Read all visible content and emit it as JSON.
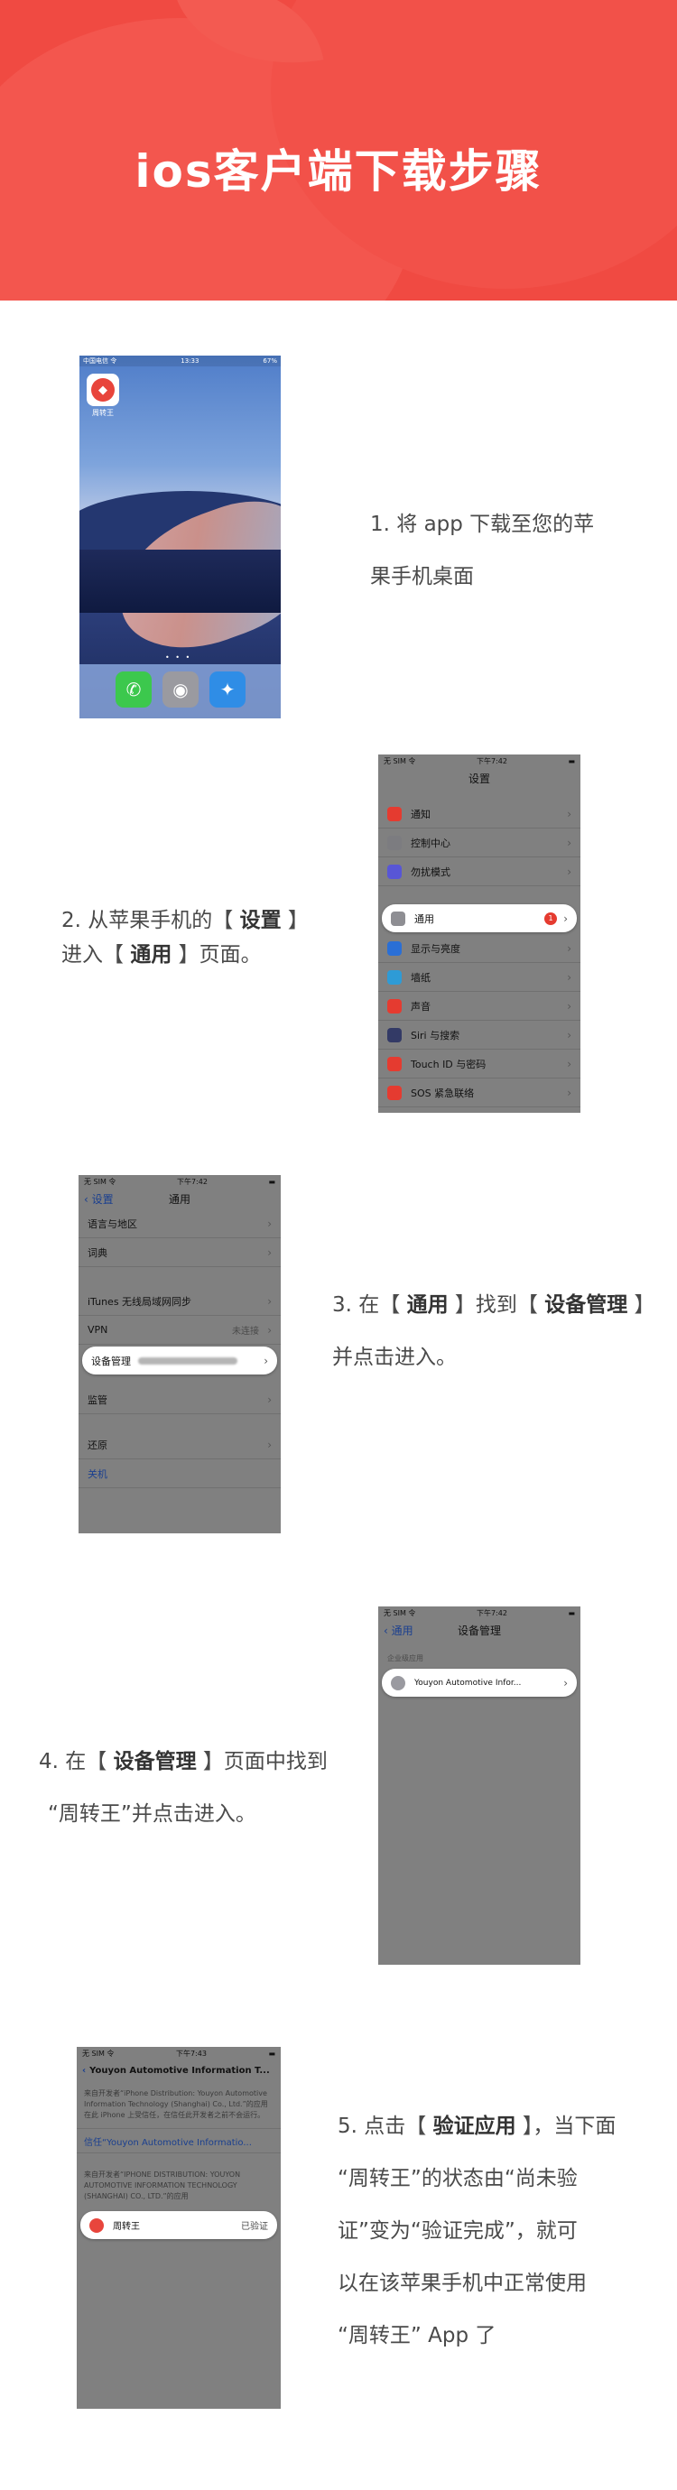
{
  "header": {
    "title": "ios客户端下载步骤"
  },
  "steps": {
    "step1": {
      "line1": "1. 将 app 下载至您的苹",
      "line2": "果手机桌面"
    },
    "step2": {
      "line1_prefix": "2. 从苹果手机的【 ",
      "line1_bold": "设置",
      "line1_suffix": " 】",
      "line2_prefix": "进入【 ",
      "line2_bold": "通用",
      "line2_suffix": " 】页面。"
    },
    "step3": {
      "line1_prefix": "3. 在【 ",
      "line1_bold1": "通用",
      "line1_mid": " 】找到【 ",
      "line1_bold2": "设备管理",
      "line1_suffix": " 】",
      "line2": "并点击进入。"
    },
    "step4": {
      "line1_prefix": "4. 在【 ",
      "line1_bold": "设备管理",
      "line1_suffix": " 】页面中找到",
      "line2": "“周转王”并点击进入。"
    },
    "step5": {
      "line1_prefix": "5. 点击【 ",
      "line1_bold": "验证应用",
      "line1_suffix": " 】，当下面",
      "line2": "“周转王”的状态由“尚未验",
      "line3": "证”变为“验证完成”，就可",
      "line4": "以在该苹果手机中正常使用",
      "line5": "“周转王” App 了"
    }
  },
  "screen1": {
    "status_left": "中国电信 令",
    "status_time": "13:33",
    "status_right": "67%",
    "app_name": "周转王",
    "dock_icons": [
      "phone-icon",
      "camera-icon",
      "safari-icon"
    ]
  },
  "screen2": {
    "status_left": "无 SIM 令",
    "status_time": "下午7:42",
    "title": "设置",
    "group1": [
      "通知",
      "控制中心",
      "勿扰模式"
    ],
    "group2": [
      "通用",
      "显示与亮度",
      "墙纸",
      "声音",
      "Siri 与搜索",
      "Touch ID 与密码",
      "SOS 紧急联络"
    ],
    "badge": "1",
    "colors": [
      "#e53b30",
      "#7c7c80",
      "#5856d6",
      "#8e8e93",
      "#2a6fd6",
      "#2e9bd6",
      "#e53b30",
      "#333a66",
      "#e53b30",
      "#e53b30"
    ]
  },
  "screen3": {
    "status_left": "无 SIM 令",
    "status_time": "下午7:42",
    "back": "设置",
    "title": "通用",
    "rows_a": [
      "语言与地区",
      "词典"
    ],
    "rows_b": [
      "iTunes 无线局域网同步",
      "VPN"
    ],
    "vpn_value": "未连接",
    "device_mgmt": "设备管理",
    "rows_c": [
      "监管"
    ],
    "reset": "还原",
    "shutdown": "关机"
  },
  "screen4": {
    "status_left": "无 SIM 令",
    "status_time": "下午7:42",
    "back": "通用",
    "title": "设备管理",
    "section": "企业级应用",
    "item": "Youyon Automotive Infor..."
  },
  "screen5": {
    "status_left": "无 SIM 令",
    "status_time": "下午7:43",
    "title": "Youyon Automotive Information T...",
    "desc1": "来自开发者“iPhone Distribution: Youyon Automotive Information Technology (Shanghai) Co., Ltd.”的应用在此 iPhone 上受信任，在信任此开发者之前不会运行。",
    "trust": "信任“Youyon Automotive Informatio...",
    "desc2": "来自开发者“IPHONE DISTRIBUTION: YOUYON AUTOMOTIVE INFORMATION TECHNOLOGY (SHANGHAI) CO., LTD.”的应用",
    "app_name": "周转王",
    "app_status": "已验证"
  }
}
